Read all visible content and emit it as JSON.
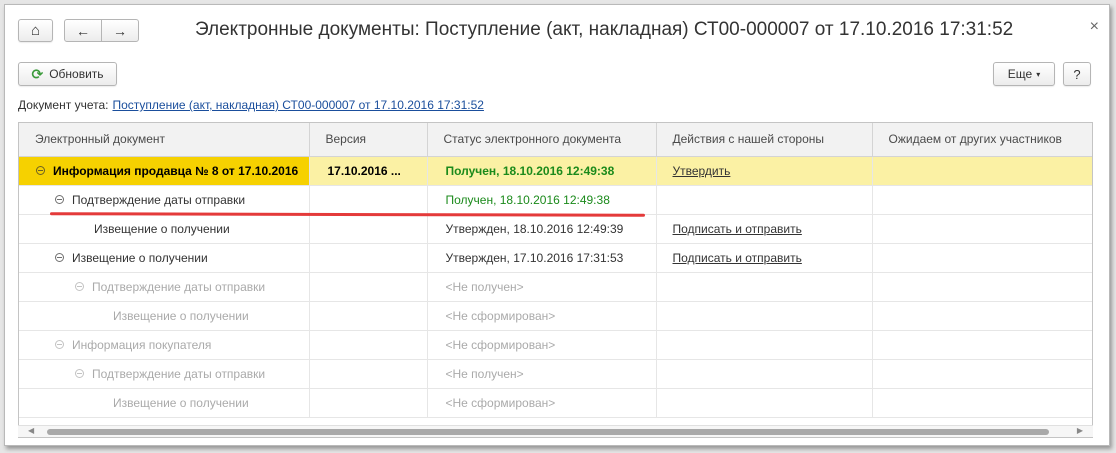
{
  "window": {
    "title": "Электронные документы: Поступление (акт, накладная) СТ00-000007 от 17.10.2016 17:31:52",
    "close_glyph": "×"
  },
  "toolbar": {
    "home_glyph": "⌂",
    "back_glyph": "←",
    "forward_glyph": "→",
    "refresh_label": "Обновить",
    "refresh_glyph": "⟳",
    "more_label": "Еще",
    "more_caret": "▾",
    "help_label": "?"
  },
  "document": {
    "label": "Документ учета:",
    "link": "Поступление (акт, накладная) СТ00-000007 от 17.10.2016 17:31:52"
  },
  "columns": [
    "Электронный документ",
    "Версия",
    "Статус электронного документа",
    "Действия с нашей стороны",
    "Ожидаем от других участников"
  ],
  "rows": [
    {
      "name": "Информация продавца № 8 от 17.10.2016",
      "version": "17.10.2016 ...",
      "status": "Получен, 18.10.2016 12:49:38",
      "action": "Утвердить",
      "waiting": ""
    },
    {
      "name": "Подтверждение даты отправки",
      "version": "",
      "status": "Получен, 18.10.2016 12:49:38",
      "action": "",
      "waiting": ""
    },
    {
      "name": "Извещение о получении",
      "version": "",
      "status": "Утвержден, 18.10.2016 12:49:39",
      "action": "Подписать и отправить",
      "waiting": ""
    },
    {
      "name": "Извещение о получении",
      "version": "",
      "status": "Утвержден, 17.10.2016 17:31:53",
      "action": "Подписать и отправить",
      "waiting": ""
    },
    {
      "name": "Подтверждение даты отправки",
      "version": "",
      "status": "<Не получен>",
      "action": "",
      "waiting": ""
    },
    {
      "name": "Извещение о получении",
      "version": "",
      "status": "<Не сформирован>",
      "action": "",
      "waiting": ""
    },
    {
      "name": "Информация покупателя",
      "version": "",
      "status": "<Не сформирован>",
      "action": "",
      "waiting": ""
    },
    {
      "name": "Подтверждение даты отправки",
      "version": "",
      "status": "<Не получен>",
      "action": "",
      "waiting": ""
    },
    {
      "name": "Извещение о получении",
      "version": "",
      "status": "<Не сформирован>",
      "action": "",
      "waiting": ""
    }
  ],
  "colors": {
    "selected_row": "#fbf1a4",
    "selected_cell": "#f6d100",
    "status_green": "#1b8a1b",
    "inactive_gray": "#aaaaaa",
    "annotation_red": "#e43a3a"
  }
}
